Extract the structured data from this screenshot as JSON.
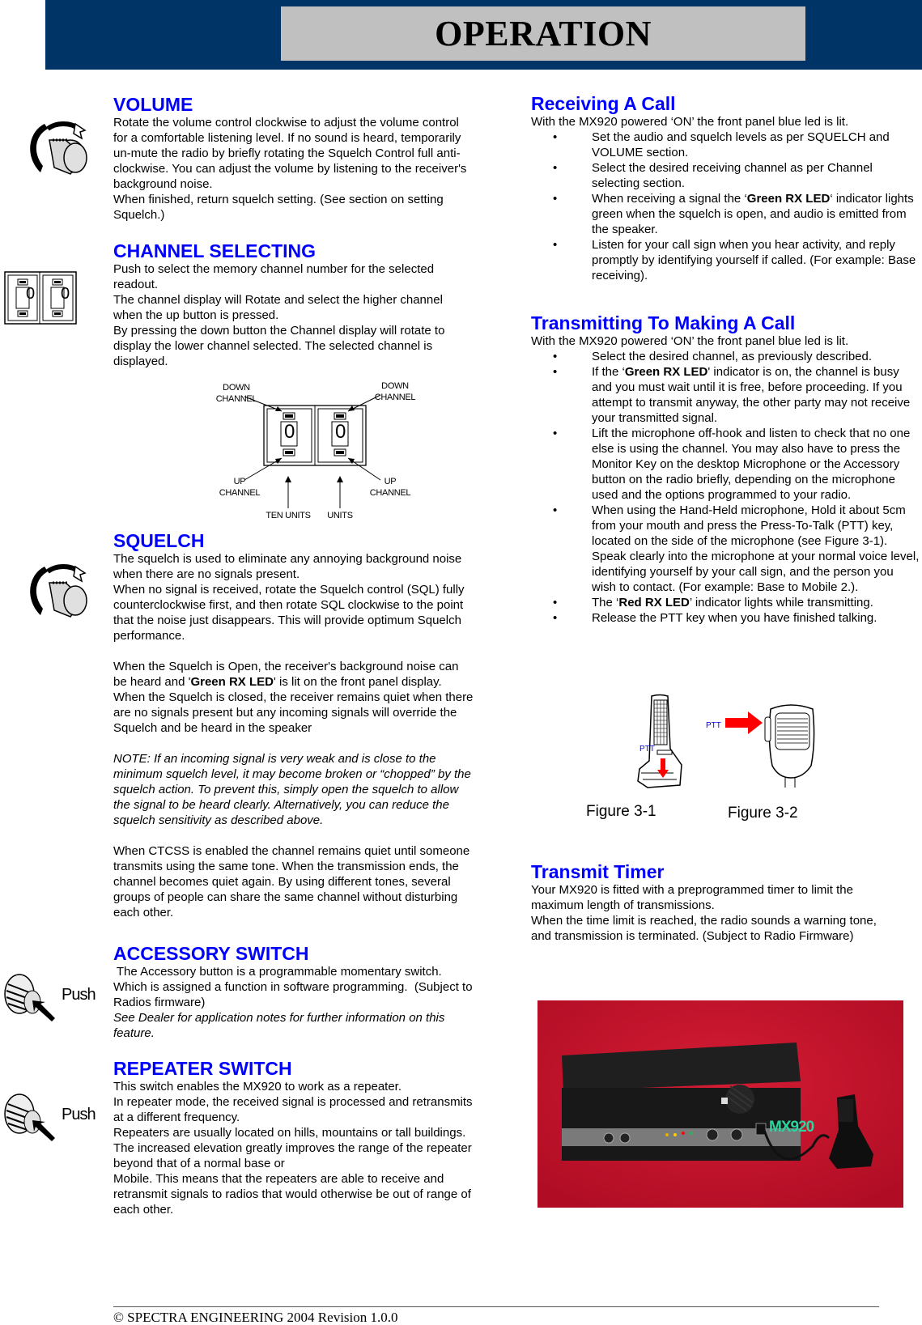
{
  "banner": {
    "title": "OPERATION"
  },
  "left": {
    "volume": {
      "heading": "VOLUME",
      "icon": "rotary-knob-icon",
      "lines": [
        "Rotate the volume control clockwise to adjust the volume control",
        "for a comfortable listening level. If no sound is heard, temporarily",
        "un-mute the radio by briefly rotating the Squelch Control full anti-",
        "clockwise. You can adjust the volume by listening to the receiver's",
        "background noise.",
        "When finished, return squelch setting. (See section on setting",
        "Squelch.)"
      ]
    },
    "channel": {
      "heading": "CHANNEL SELECTING",
      "icon": "channel-selector-icon",
      "display_digits": [
        "0",
        "0"
      ],
      "lines": [
        "Push to select the memory channel number for the selected",
        "readout.",
        "The channel display will Rotate and select the higher channel",
        "when the up button is pressed.",
        "By pressing the down button the Channel display will rotate to",
        "display the lower channel selected. The selected channel is",
        "displayed."
      ],
      "diagram": {
        "down_left": [
          "DOWN",
          "CHANNEL"
        ],
        "down_right": [
          "DOWN",
          "CHANNEL"
        ],
        "up_left": [
          "UP",
          "CHANNEL"
        ],
        "up_right": [
          "UP",
          "CHANNEL"
        ],
        "ten_units": "TEN UNITS",
        "units": "UNITS",
        "digits": [
          "0",
          "0"
        ]
      }
    },
    "squelch": {
      "heading": "SQUELCH",
      "icon": "rotary-knob-icon",
      "para1": [
        "The squelch is used to eliminate any annoying background noise",
        "when there are no signals present.",
        "When no signal is received, rotate the Squelch control (SQL) fully",
        "counterclockwise first, and then rotate SQL clockwise to the point",
        "that the noise just disappears. This will provide optimum Squelch",
        "performance."
      ],
      "para2_line1": "When the Squelch is Open, the receiver's background noise can",
      "para2_line2_pre": "be heard and '",
      "para2_line2_bold": "Green RX LED",
      "para2_line2_post": "' is lit on the front panel display.",
      "para2_rest": [
        "When the Squelch is closed, the receiver remains quiet when there",
        "are no signals present but any incoming signals will override the",
        "Squelch and be heard in the speaker"
      ],
      "note": [
        "NOTE: If an incoming signal is very weak and is close to the",
        "minimum squelch level, it may become broken or “chopped” by the",
        "squelch action. To prevent this, simply open the squelch to allow",
        "the signal to be heard clearly. Alternatively, you can reduce the",
        "squelch sensitivity as described above."
      ],
      "ctcss": [
        "When CTCSS is enabled the channel remains quiet until someone",
        "transmits using the same tone. When the transmission ends, the",
        "channel becomes quiet again. By using different tones, several",
        "groups of people can share the same channel without disturbing",
        "each other."
      ]
    },
    "accessory": {
      "heading": "ACCESSORY SWITCH",
      "icon": "push-knob-icon",
      "push_label": "Push",
      "lines": [
        " The Accessory button is a programmable momentary switch.",
        "Which is assigned a function in software programming.  (Subject to",
        "Radios firmware)"
      ],
      "italic_lines": [
        "See Dealer for application notes for further information on this",
        "feature."
      ]
    },
    "repeater": {
      "heading": "REPEATER SWITCH",
      "icon": "push-knob-icon",
      "push_label": "Push",
      "lines": [
        "This switch enables the MX920 to work as a repeater.",
        "In repeater mode, the received signal is processed and retransmits",
        "at a different frequency.",
        "Repeaters are usually located on hills, mountains or tall buildings.",
        "The increased elevation greatly improves the range of the repeater",
        "beyond that of a normal base or",
        "Mobile. This means that the repeaters are able to receive and",
        "retransmit signals to radios that would otherwise be out of range of",
        "each other."
      ]
    }
  },
  "right": {
    "receiving": {
      "heading": "Receiving A Call",
      "intro": "With the MX920 powered ‘ON’ the front panel blue led is lit.",
      "bullets": [
        {
          "pre": "Set the audio and squelch levels as per SQUELCH and VOLUME section.",
          "bold": "",
          "post": ""
        },
        {
          "pre": "Select the desired receiving channel as per Channel selecting section.",
          "bold": "",
          "post": ""
        },
        {
          "pre": "When receiving a signal the ‘",
          "bold": "Green RX LED",
          "post": "‘ indicator lights green when the squelch is open, and audio is emitted from the speaker."
        },
        {
          "pre": "Listen for your call sign when you hear activity, and reply promptly by identifying yourself if called. (For example: Base receiving).",
          "bold": "",
          "post": ""
        }
      ]
    },
    "transmitting": {
      "heading": "Transmitting To Making A Call",
      "intro": "With the MX920 powered ‘ON’ the front panel blue led is lit.",
      "bullets": [
        {
          "pre": "Select the desired channel, as previously described.",
          "bold": "",
          "post": ""
        },
        {
          "pre": "If the ‘",
          "bold": "Green RX LED",
          "post": "' indicator is on, the channel is busy and you must wait until it is free, before proceeding. If you attempt to transmit anyway, the other party may not receive your transmitted signal."
        },
        {
          "pre": "Lift the microphone off-hook and listen to check that no one else is using the channel. You may also have to press the Monitor Key on the desktop Microphone or the Accessory button on the radio briefly, depending on the microphone used and the options programmed to your radio.",
          "bold": "",
          "post": ""
        },
        {
          "pre": "When using the Hand-Held microphone, Hold it about 5cm from your mouth and press the Press-To-Talk (PTT) key, located on the side of the microphone (see Figure 3-1). Speak clearly into the microphone at your normal voice level, identifying yourself by your call sign, and the person you wish to contact. (For example: Base to Mobile 2.).",
          "bold": "",
          "post": ""
        },
        {
          "pre": "The ‘",
          "bold": "Red RX LED",
          "post": "’ indicator lights while transmitting."
        },
        {
          "pre": "Release the PTT key when you have finished talking.",
          "bold": "",
          "post": ""
        }
      ]
    },
    "figures": {
      "ptt_label_1": "PTT",
      "ptt_label_2": "PTT",
      "caption_1": "Figure 3-1",
      "caption_2": "Figure 3-2",
      "arrow_color": "#ff0000"
    },
    "timer": {
      "heading": "Transmit Timer",
      "lines": [
        "Your MX920 is fitted with a preprogrammed timer to limit the",
        "maximum length of transmissions.",
        "When the time limit is reached, the radio sounds a warning tone,",
        "and transmission is terminated. (Subject to Radio Firmware)"
      ]
    },
    "photo": {
      "brand_label": "MX920",
      "background_color": "#c8102e",
      "alt": "MX920 base station with desktop microphone"
    }
  },
  "footer": {
    "text": "© SPECTRA ENGINEERING 2004 Revision 1.0.0"
  },
  "colors": {
    "heading": "#0000ff",
    "banner": "#003366",
    "banner_box": "#c0c0c0"
  }
}
